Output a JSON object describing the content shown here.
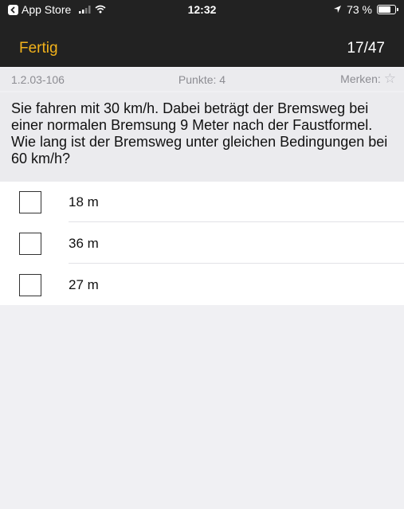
{
  "status_bar": {
    "back_app": "App Store",
    "time": "12:32",
    "battery": "73 %",
    "battery_level": 0.73
  },
  "nav": {
    "done_label": "Fertig",
    "progress": "17/47"
  },
  "meta": {
    "question_id": "1.2.03-106",
    "points": "Punkte: 4",
    "bookmark_label": "Merken:"
  },
  "question": {
    "text": "Sie fahren mit 30 km/h. Dabei beträgt der Bremsweg bei einer normalen Bremsung 9 Meter nach der Faustformel. Wie lang ist der Bremsweg unter gleichen Bedingungen bei 60 km/h?"
  },
  "answers": [
    {
      "label": "18 m",
      "checked": false
    },
    {
      "label": "36 m",
      "checked": false
    },
    {
      "label": "27 m",
      "checked": false
    }
  ],
  "colors": {
    "accent": "#f2b21b",
    "bar_background": "#222222",
    "page_background": "#f0f0f3"
  }
}
